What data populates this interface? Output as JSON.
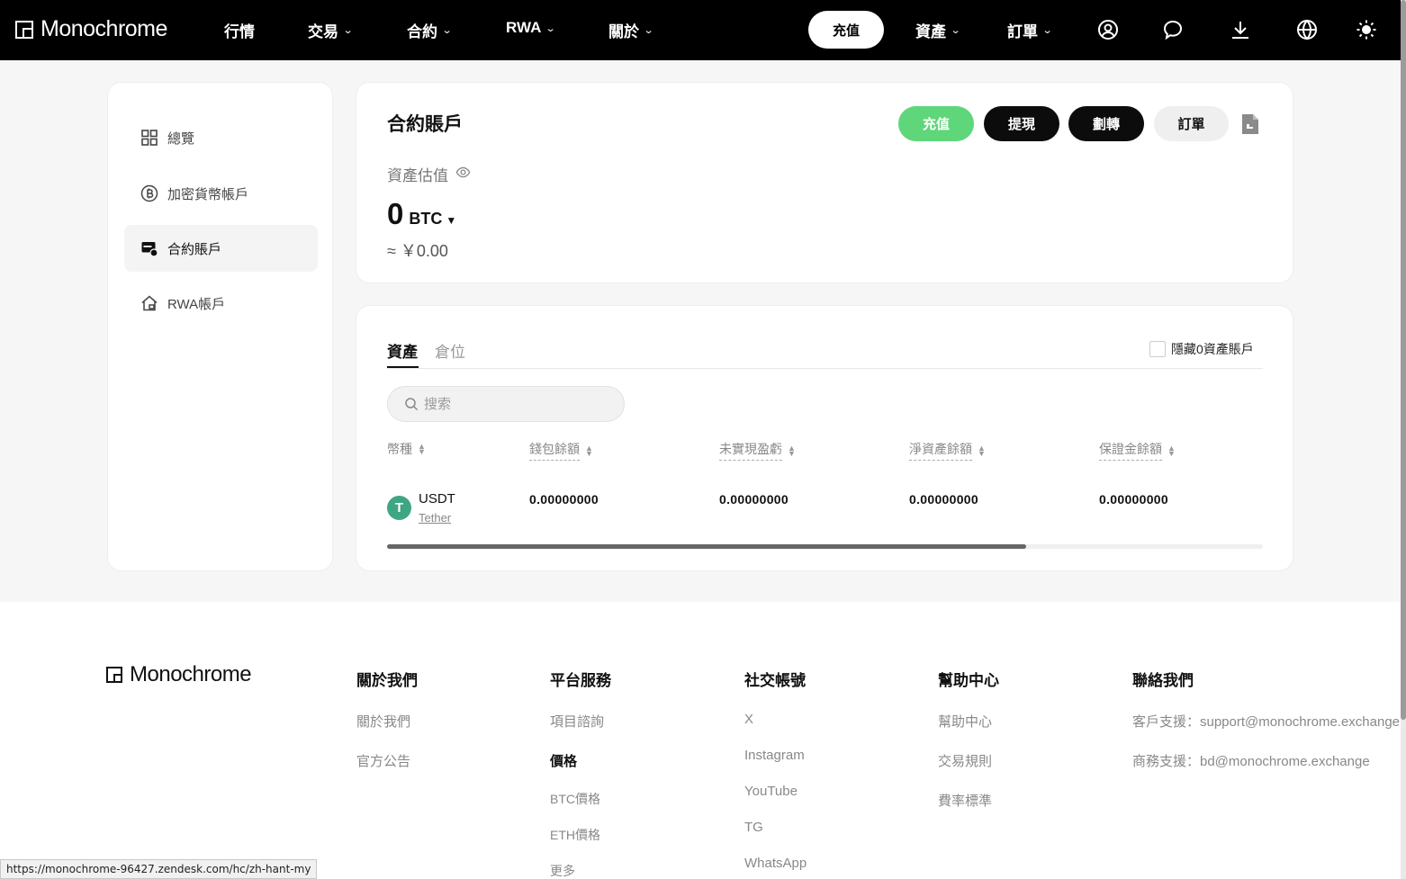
{
  "nav": {
    "brand": "Monochrome",
    "items": [
      {
        "label": "行情",
        "dropdown": false
      },
      {
        "label": "交易",
        "dropdown": true
      },
      {
        "label": "合約",
        "dropdown": true
      },
      {
        "label": "RWA",
        "dropdown": true
      },
      {
        "label": "關於",
        "dropdown": true
      }
    ],
    "deposit": "充值",
    "assets": "資產",
    "orders": "訂單",
    "icons": [
      "user-icon",
      "chat-icon",
      "download-icon",
      "globe-icon",
      "sun-icon"
    ]
  },
  "sidebar": {
    "items": [
      {
        "label": "總覽",
        "icon": "grid-icon",
        "active": false
      },
      {
        "label": "加密貨幣帳戶",
        "icon": "bitcoin-icon",
        "active": false
      },
      {
        "label": "合約賬戶",
        "icon": "contract-wallet-icon",
        "active": true
      },
      {
        "label": "RWA帳戶",
        "icon": "house-icon",
        "active": false
      }
    ]
  },
  "account": {
    "title": "合約賬戶",
    "buttons": {
      "deposit": "充值",
      "withdraw": "提現",
      "transfer": "劃轉",
      "orders": "訂單"
    },
    "valuation_label": "資產估值",
    "balance": "0",
    "currency": "BTC",
    "approx": "≈ ￥0.00"
  },
  "assets": {
    "tabs": [
      "資產",
      "倉位"
    ],
    "hide_zero": "隱藏0資產賬戶",
    "search_placeholder": "搜索",
    "columns": [
      "幣種",
      "錢包餘額",
      "未實現盈虧",
      "淨資產餘額",
      "保證金餘額"
    ],
    "rows": [
      {
        "symbol": "USDT",
        "name": "Tether",
        "wallet": "0.00000000",
        "unrealized": "0.00000000",
        "net": "0.00000000",
        "margin": "0.00000000"
      }
    ]
  },
  "footer": {
    "brand": "Monochrome",
    "about": {
      "title": "關於我們",
      "links": [
        "關於我們",
        "官方公告"
      ]
    },
    "services": {
      "title": "平台服務",
      "links": [
        "項目諮詢"
      ],
      "price_title": "價格",
      "price_links": [
        "BTC價格",
        "ETH價格",
        "更多"
      ]
    },
    "social": {
      "title": "社交帳號",
      "links": [
        "X",
        "Instagram",
        "YouTube",
        "TG",
        "WhatsApp"
      ]
    },
    "help": {
      "title": "幫助中心",
      "links": [
        "幫助中心",
        "交易規則",
        "費率標準"
      ]
    },
    "contact": {
      "title": "聯絡我們",
      "support": "客戶支援：support@monochrome.exchange",
      "business": "商務支援：bd@monochrome.exchange"
    }
  },
  "status_url": "https://monochrome-96427.zendesk.com/hc/zh-hant-my",
  "colors": {
    "accent_green": "#5fd67a",
    "tether_green": "#3fa684",
    "nav_bg": "#000000"
  }
}
